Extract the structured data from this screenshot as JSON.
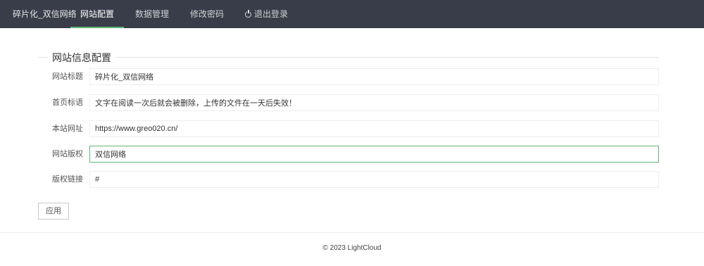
{
  "header": {
    "brand": "碎片化_双信网络",
    "nav": [
      {
        "label": "网站配置",
        "active": true
      },
      {
        "label": "数据管理",
        "active": false
      },
      {
        "label": "修改密码",
        "active": false
      },
      {
        "label": "退出登录",
        "active": false,
        "icon": "power-icon"
      }
    ],
    "bg_color": "#393d49",
    "accent_color": "#5fb878"
  },
  "main": {
    "section_title": "网站信息配置",
    "fields": [
      {
        "label": "网站标题",
        "value": "碎片化_双信网络"
      },
      {
        "label": "首页标语",
        "value": "文字在阅读一次后就会被删除，上传的文件在一天后失效！"
      },
      {
        "label": "本站网址",
        "value": "https://www.greo020.cn/"
      },
      {
        "label": "网站版权",
        "value": "双信网络",
        "focused": true
      },
      {
        "label": "版权链接",
        "value": "#"
      }
    ],
    "apply_label": "应用"
  },
  "footer": {
    "text": "© 2023 LightCloud"
  }
}
